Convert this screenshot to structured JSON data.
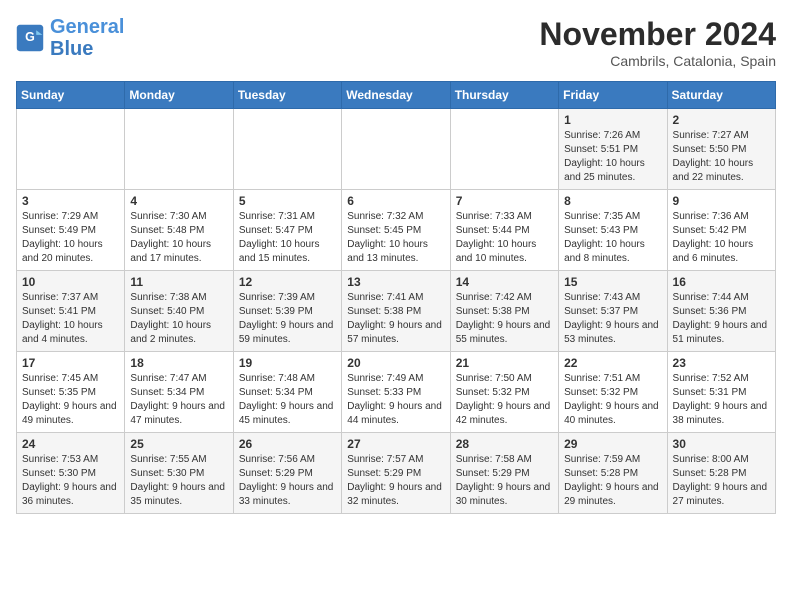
{
  "logo": {
    "line1": "General",
    "line2": "Blue"
  },
  "title": "November 2024",
  "location": "Cambrils, Catalonia, Spain",
  "days_of_week": [
    "Sunday",
    "Monday",
    "Tuesday",
    "Wednesday",
    "Thursday",
    "Friday",
    "Saturday"
  ],
  "weeks": [
    [
      {
        "day": "",
        "info": ""
      },
      {
        "day": "",
        "info": ""
      },
      {
        "day": "",
        "info": ""
      },
      {
        "day": "",
        "info": ""
      },
      {
        "day": "",
        "info": ""
      },
      {
        "day": "1",
        "info": "Sunrise: 7:26 AM\nSunset: 5:51 PM\nDaylight: 10 hours and 25 minutes."
      },
      {
        "day": "2",
        "info": "Sunrise: 7:27 AM\nSunset: 5:50 PM\nDaylight: 10 hours and 22 minutes."
      }
    ],
    [
      {
        "day": "3",
        "info": "Sunrise: 7:29 AM\nSunset: 5:49 PM\nDaylight: 10 hours and 20 minutes."
      },
      {
        "day": "4",
        "info": "Sunrise: 7:30 AM\nSunset: 5:48 PM\nDaylight: 10 hours and 17 minutes."
      },
      {
        "day": "5",
        "info": "Sunrise: 7:31 AM\nSunset: 5:47 PM\nDaylight: 10 hours and 15 minutes."
      },
      {
        "day": "6",
        "info": "Sunrise: 7:32 AM\nSunset: 5:45 PM\nDaylight: 10 hours and 13 minutes."
      },
      {
        "day": "7",
        "info": "Sunrise: 7:33 AM\nSunset: 5:44 PM\nDaylight: 10 hours and 10 minutes."
      },
      {
        "day": "8",
        "info": "Sunrise: 7:35 AM\nSunset: 5:43 PM\nDaylight: 10 hours and 8 minutes."
      },
      {
        "day": "9",
        "info": "Sunrise: 7:36 AM\nSunset: 5:42 PM\nDaylight: 10 hours and 6 minutes."
      }
    ],
    [
      {
        "day": "10",
        "info": "Sunrise: 7:37 AM\nSunset: 5:41 PM\nDaylight: 10 hours and 4 minutes."
      },
      {
        "day": "11",
        "info": "Sunrise: 7:38 AM\nSunset: 5:40 PM\nDaylight: 10 hours and 2 minutes."
      },
      {
        "day": "12",
        "info": "Sunrise: 7:39 AM\nSunset: 5:39 PM\nDaylight: 9 hours and 59 minutes."
      },
      {
        "day": "13",
        "info": "Sunrise: 7:41 AM\nSunset: 5:38 PM\nDaylight: 9 hours and 57 minutes."
      },
      {
        "day": "14",
        "info": "Sunrise: 7:42 AM\nSunset: 5:38 PM\nDaylight: 9 hours and 55 minutes."
      },
      {
        "day": "15",
        "info": "Sunrise: 7:43 AM\nSunset: 5:37 PM\nDaylight: 9 hours and 53 minutes."
      },
      {
        "day": "16",
        "info": "Sunrise: 7:44 AM\nSunset: 5:36 PM\nDaylight: 9 hours and 51 minutes."
      }
    ],
    [
      {
        "day": "17",
        "info": "Sunrise: 7:45 AM\nSunset: 5:35 PM\nDaylight: 9 hours and 49 minutes."
      },
      {
        "day": "18",
        "info": "Sunrise: 7:47 AM\nSunset: 5:34 PM\nDaylight: 9 hours and 47 minutes."
      },
      {
        "day": "19",
        "info": "Sunrise: 7:48 AM\nSunset: 5:34 PM\nDaylight: 9 hours and 45 minutes."
      },
      {
        "day": "20",
        "info": "Sunrise: 7:49 AM\nSunset: 5:33 PM\nDaylight: 9 hours and 44 minutes."
      },
      {
        "day": "21",
        "info": "Sunrise: 7:50 AM\nSunset: 5:32 PM\nDaylight: 9 hours and 42 minutes."
      },
      {
        "day": "22",
        "info": "Sunrise: 7:51 AM\nSunset: 5:32 PM\nDaylight: 9 hours and 40 minutes."
      },
      {
        "day": "23",
        "info": "Sunrise: 7:52 AM\nSunset: 5:31 PM\nDaylight: 9 hours and 38 minutes."
      }
    ],
    [
      {
        "day": "24",
        "info": "Sunrise: 7:53 AM\nSunset: 5:30 PM\nDaylight: 9 hours and 36 minutes."
      },
      {
        "day": "25",
        "info": "Sunrise: 7:55 AM\nSunset: 5:30 PM\nDaylight: 9 hours and 35 minutes."
      },
      {
        "day": "26",
        "info": "Sunrise: 7:56 AM\nSunset: 5:29 PM\nDaylight: 9 hours and 33 minutes."
      },
      {
        "day": "27",
        "info": "Sunrise: 7:57 AM\nSunset: 5:29 PM\nDaylight: 9 hours and 32 minutes."
      },
      {
        "day": "28",
        "info": "Sunrise: 7:58 AM\nSunset: 5:29 PM\nDaylight: 9 hours and 30 minutes."
      },
      {
        "day": "29",
        "info": "Sunrise: 7:59 AM\nSunset: 5:28 PM\nDaylight: 9 hours and 29 minutes."
      },
      {
        "day": "30",
        "info": "Sunrise: 8:00 AM\nSunset: 5:28 PM\nDaylight: 9 hours and 27 minutes."
      }
    ]
  ]
}
